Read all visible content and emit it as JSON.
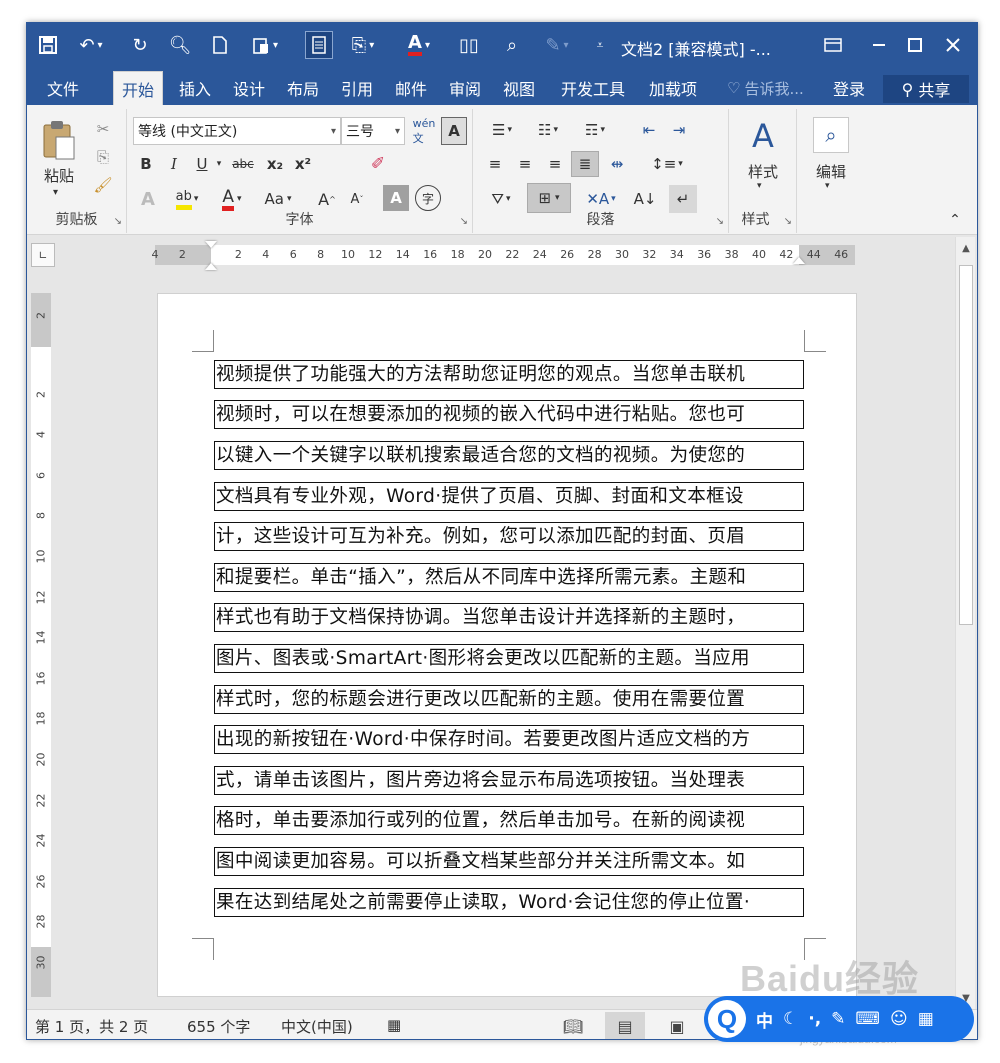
{
  "window": {
    "title": "文档2 [兼容模式] -...",
    "min_icon": "minimize-icon",
    "max_icon": "maximize-icon",
    "close_icon": "close-icon"
  },
  "qat": [
    "save-icon",
    "undo-icon",
    "redo-icon",
    "print-preview-icon",
    "new-doc-icon",
    "paste-icon",
    "document-icon",
    "format-painter-icon",
    "font-color-icon",
    "columns-icon",
    "search-icon",
    "draw-icon",
    "customize-icon"
  ],
  "tabs": [
    {
      "label": "文件",
      "active": false
    },
    {
      "label": "开始",
      "active": true
    },
    {
      "label": "插入",
      "active": false
    },
    {
      "label": "设计",
      "active": false
    },
    {
      "label": "布局",
      "active": false
    },
    {
      "label": "引用",
      "active": false
    },
    {
      "label": "邮件",
      "active": false
    },
    {
      "label": "审阅",
      "active": false
    },
    {
      "label": "视图",
      "active": false
    },
    {
      "label": "开发工具",
      "active": false
    },
    {
      "label": "加载项",
      "active": false
    }
  ],
  "tellme": "告诉我...",
  "login": "登录",
  "share": "共享",
  "ribbon": {
    "clipboard": {
      "label": "剪贴板",
      "paste": "粘贴"
    },
    "font": {
      "label": "字体",
      "font_name": "等线 (中文正文)",
      "font_size": "三号",
      "buttons": [
        "B",
        "I",
        "U",
        "abc",
        "x₂",
        "x²",
        "Aa"
      ]
    },
    "paragraph": {
      "label": "段落"
    },
    "styles": {
      "label": "样式",
      "button": "样式"
    },
    "editing": {
      "label": "编辑",
      "button": "编辑"
    }
  },
  "ruler": {
    "h_ticks": [
      "4",
      "2",
      "2",
      "4",
      "6",
      "8",
      "10",
      "12",
      "14",
      "16",
      "18",
      "20",
      "22",
      "24",
      "26",
      "28",
      "30",
      "32",
      "34",
      "36",
      "38",
      "40",
      "42",
      "44",
      "46"
    ],
    "v_ticks": [
      "2",
      "2",
      "4",
      "6",
      "8",
      "10",
      "12",
      "14",
      "16",
      "18",
      "20",
      "22",
      "24",
      "26",
      "28",
      "30"
    ]
  },
  "document": {
    "lines": [
      "视频提供了功能强大的方法帮助您证明您的观点。当您单击联机",
      "视频时，可以在想要添加的视频的嵌入代码中进行粘贴。您也可",
      "以键入一个关键字以联机搜索最适合您的文档的视频。为使您的",
      "文档具有专业外观，Word·提供了页眉、页脚、封面和文本框设",
      "计，这些设计可互为补充。例如，您可以添加匹配的封面、页眉",
      "和提要栏。单击“插入”，然后从不同库中选择所需元素。主题和",
      "样式也有助于文档保持协调。当您单击设计并选择新的主题时，",
      "图片、图表或·SmartArt·图形将会更改以匹配新的主题。当应用",
      "样式时，您的标题会进行更改以匹配新的主题。使用在需要位置",
      "出现的新按钮在·Word·中保存时间。若要更改图片适应文档的方",
      "式，请单击该图片，图片旁边将会显示布局选项按钮。当处理表",
      "格时，单击要添加行或列的位置，然后单击加号。在新的阅读视",
      "图中阅读更加容易。可以折叠文档某些部分并关注所需文本。如",
      "果在达到结尾处之前需要停止读取，Word·会记住您的停止位置·"
    ]
  },
  "status": {
    "page": "第 1 页，共 2 页",
    "words": "655 个字",
    "lang": "中文(中国)"
  },
  "watermark": "Baidu经验",
  "watermark_sub": "jingyan.baidu.com",
  "ime": {
    "logo": "Q",
    "mode": "中"
  },
  "colors": {
    "accent": "#2b579a",
    "ime": "#1a73e8"
  }
}
